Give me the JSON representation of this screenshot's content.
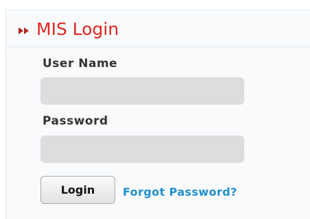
{
  "header": {
    "title": "MIS Login",
    "icon": "double-arrow-right-icon",
    "title_color": "#e0261f"
  },
  "form": {
    "username_label": "User Name",
    "username_value": "",
    "password_label": "Password",
    "password_value": "",
    "login_label": "Login",
    "forgot_label": "Forgot Password?",
    "link_color": "#1f8fcf"
  }
}
